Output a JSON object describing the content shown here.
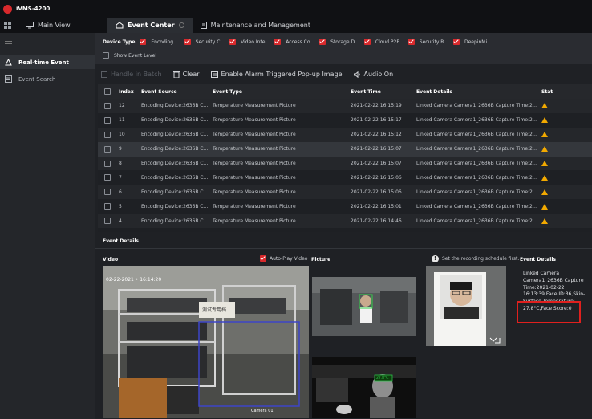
{
  "app": {
    "title": "iVMS-4200"
  },
  "tabs": [
    {
      "label": "Main View"
    },
    {
      "label": "Event Center"
    },
    {
      "label": "Maintenance and Management"
    }
  ],
  "sidebar": {
    "items": [
      {
        "label": "Real-time Event",
        "active": true
      },
      {
        "label": "Event Search",
        "active": false
      }
    ]
  },
  "filters": {
    "device_type_label": "Device Type",
    "types": [
      "Encoding ...",
      "Security C...",
      "Video Inte...",
      "Access Co...",
      "Storage D...",
      "Cloud P2P...",
      "Security R...",
      "DeepinMi..."
    ],
    "show_event_level": "Show Event Level"
  },
  "toolbar": {
    "handle_in_batch": "Handle in Batch",
    "clear": "Clear",
    "enable_popup": "Enable Alarm Triggered Pop-up Image",
    "audio_on": "Audio On"
  },
  "table": {
    "headers": {
      "index": "Index",
      "source": "Event Source",
      "type": "Event Type",
      "time": "Event Time",
      "details": "Event Details",
      "status": "Stat"
    },
    "rows": [
      {
        "index": "12",
        "source": "Encoding Device:2636B Came...",
        "type": "Temperature Measurement Picture",
        "time": "2021-02-22 16:15:19",
        "details": "Linked Camera Camera1_2636B Capture Time:2021-02-..."
      },
      {
        "index": "11",
        "source": "Encoding Device:2636B Came...",
        "type": "Temperature Measurement Picture",
        "time": "2021-02-22 16:15:17",
        "details": "Linked Camera Camera1_2636B Capture Time:2021-02-..."
      },
      {
        "index": "10",
        "source": "Encoding Device:2636B Came...",
        "type": "Temperature Measurement Picture",
        "time": "2021-02-22 16:15:12",
        "details": "Linked Camera Camera1_2636B Capture Time:2021-02-..."
      },
      {
        "index": "9",
        "source": "Encoding Device:2636B Came...",
        "type": "Temperature Measurement Picture",
        "time": "2021-02-22 16:15:07",
        "details": "Linked Camera Camera1_2636B Capture Time:2021-02-..."
      },
      {
        "index": "8",
        "source": "Encoding Device:2636B Came...",
        "type": "Temperature Measurement Picture",
        "time": "2021-02-22 16:15:07",
        "details": "Linked Camera Camera1_2636B Capture Time:2021-02-..."
      },
      {
        "index": "7",
        "source": "Encoding Device:2636B Came...",
        "type": "Temperature Measurement Picture",
        "time": "2021-02-22 16:15:06",
        "details": "Linked Camera Camera1_2636B Capture Time:2021-02-..."
      },
      {
        "index": "6",
        "source": "Encoding Device:2636B Came...",
        "type": "Temperature Measurement Picture",
        "time": "2021-02-22 16:15:06",
        "details": "Linked Camera Camera1_2636B Capture Time:2021-02-..."
      },
      {
        "index": "5",
        "source": "Encoding Device:2636B Came...",
        "type": "Temperature Measurement Picture",
        "time": "2021-02-22 16:15:01",
        "details": "Linked Camera Camera1_2636B Capture Time:2021-02-..."
      },
      {
        "index": "4",
        "source": "Encoding Device:2636B Came...",
        "type": "Temperature Measurement Picture",
        "time": "2021-02-22 16:14:46",
        "details": "Linked Camera Camera1_2636B Capture Time:2021-02-..."
      },
      {
        "index": "3",
        "source": "Encoding Device:2636B Came...",
        "type": "Temperature Measurement Picture",
        "time": "2021-02-22 16:13:49",
        "details": "Linked Camera Camera1_2636B Capture Time:2021-02-..."
      }
    ]
  },
  "details": {
    "section_label": "Event Details",
    "video_label": "Video",
    "autoplay_label": "Auto-Play Video",
    "picture_label": "Picture",
    "schedule_hint": "Set the recording schedule first.",
    "event_details_label": "Event Details",
    "video_timestamp": "02-22-2021 • 16:14:20",
    "video_sign": "测试专用档",
    "video_camera_label": "Camera 01",
    "thermal_readout": "27.8°C",
    "event_text": [
      "Linked Camera",
      "Camera1_2636B Capture",
      "Time:2021-02-22",
      "16:13:39,Face ID:36,Skin-",
      "Surface Temperature:",
      "27.8°C,Face Score:0"
    ]
  },
  "colors": {
    "accent": "#d8292c",
    "warning": "#f2a900",
    "highlight_box": "#e0201e"
  }
}
